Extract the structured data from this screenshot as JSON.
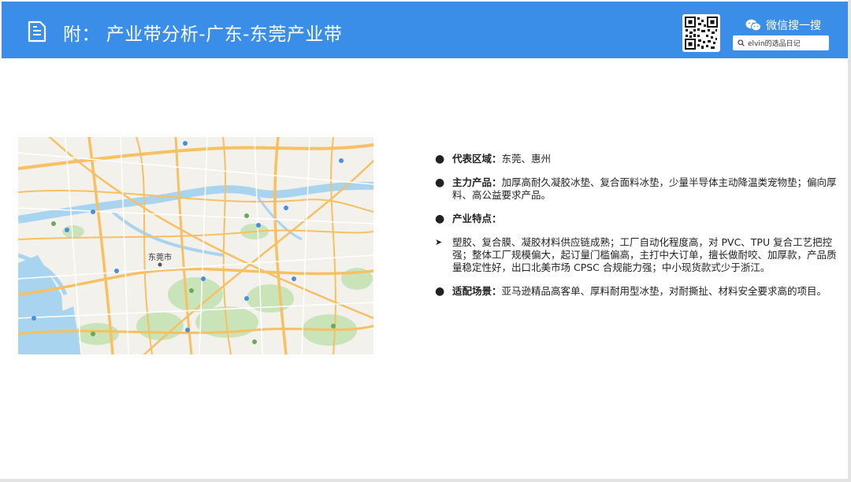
{
  "header": {
    "title": "附：  产业带分析-广东-东莞产业带",
    "brand": "微信搜一搜",
    "search_text": "elvin的选品日记",
    "icons": [
      "document-icon",
      "qr-code-icon",
      "wechat-icon",
      "search-icon"
    ]
  },
  "map": {
    "city_label": "东莞市"
  },
  "content": {
    "items": [
      {
        "label": "代表区域：",
        "text": "东莞、惠州"
      },
      {
        "label": "主力产品：",
        "text": "加厚高耐久凝胶冰垫、复合面料冰垫，少量半导体主动降温类宠物垫；偏向厚料、高公益要求产品。"
      },
      {
        "label": "产业特点：",
        "text": ""
      },
      {
        "label": "",
        "text": "塑胶、复合膜、凝胶材料供应链成熟；工厂自动化程度高，对 PVC、TPU 复合工艺把控强；整体工厂规模偏大，起订量门槛偏高，主打中大订单，擅长做耐咬、加厚款，产品质量稳定性好，出口北美市场 CPSC 合规能力强；中小现货款式少于浙江。"
      },
      {
        "label": "适配场景：",
        "text": "亚马逊精品高客单、厚料耐用型冰垫，对耐撕扯、材料安全要求高的项目。"
      }
    ]
  },
  "colors": {
    "header": "#3a8ee8",
    "water": "#a8d4f0",
    "road": "#f7c365",
    "green": "#c6e3b5"
  }
}
